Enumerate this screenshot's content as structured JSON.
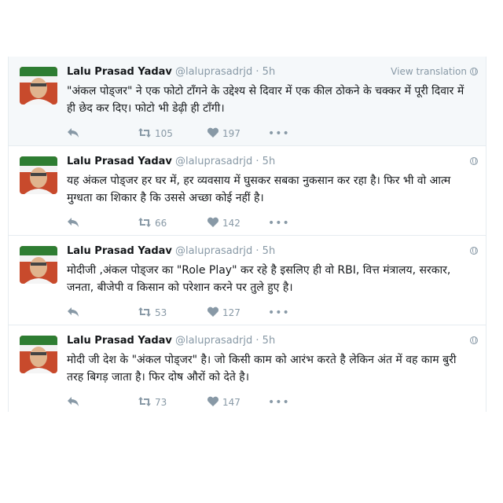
{
  "colors": {
    "text": "#14171a",
    "muted": "#8899a6",
    "border": "#e6ecf0",
    "hover_bg": "#f5f8fa"
  },
  "icons": [
    "reply-icon",
    "retweet-icon",
    "heart-icon",
    "more-icon",
    "globe-icon"
  ],
  "tweets": [
    {
      "name": "Lalu Prasad Yadav",
      "handle": "@laluprasadrjd",
      "separator": "·",
      "time": "5h",
      "translate": "View translation",
      "text": "\"अंकल पोड्जर\" ने एक फोटो टाँगने के उद्देश्य से दिवार में एक कील ठोकने के चक्कर में पूरी दिवार में ही छेद कर दिए। फोटो भी डेढ़ी ही टाँगी।",
      "retweets": "105",
      "likes": "197",
      "more": "•••"
    },
    {
      "name": "Lalu Prasad Yadav",
      "handle": "@laluprasadrjd",
      "separator": "·",
      "time": "5h",
      "text": "यह अंकल पोड्जर हर घर में, हर व्यवसाय में घुसकर सबका नुकसान कर रहा है। फिर भी वो आत्म मुग्धता का शिकार है कि उससे अच्छा कोई नहीं है।",
      "retweets": "66",
      "likes": "142",
      "more": "•••"
    },
    {
      "name": "Lalu Prasad Yadav",
      "handle": "@laluprasadrjd",
      "separator": "·",
      "time": "5h",
      "text": "मोदीजी ,अंकल पोड्जर का \"Role Play\" कर रहे है इसलिए ही वो RBI, वित्त मंत्रालय, सरकार, जनता, बीजेपी व किसान को परेशान करने पर तुले हुए है।",
      "retweets": "53",
      "likes": "127",
      "more": "•••"
    },
    {
      "name": "Lalu Prasad Yadav",
      "handle": "@laluprasadrjd",
      "separator": "·",
      "time": "5h",
      "text": "मोदी जी देश के \"अंकल पोड्जर\" है। जो किसी काम को आरंभ करते है लेकिन अंत में वह काम बुरी तरह बिगड़ जाता है। फिर दोष औरों को देते है।",
      "retweets": "73",
      "likes": "147",
      "more": "•••"
    }
  ]
}
